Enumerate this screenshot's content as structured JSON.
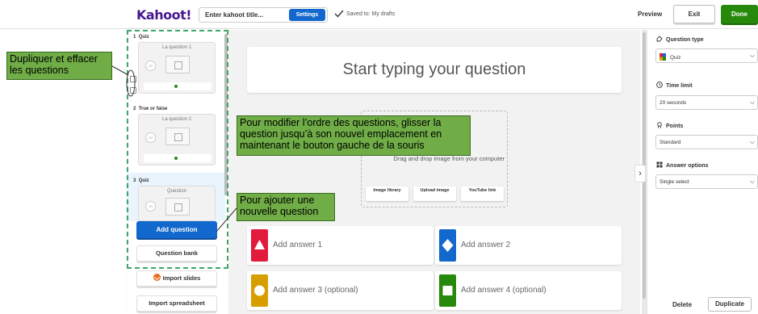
{
  "topbar": {
    "logo": "Kahoot!",
    "title_placeholder": "Enter kahoot title...",
    "settings_label": "Settings",
    "saved_text": "Saved to: My drafts",
    "preview_label": "Preview",
    "exit_label": "Exit",
    "done_label": "Done"
  },
  "slides": [
    {
      "number": "1",
      "type": "Quiz",
      "thumb_title": "La question 1",
      "timer": "20"
    },
    {
      "number": "2",
      "type": "True or false",
      "thumb_title": "La question 2",
      "timer": "20"
    },
    {
      "number": "3",
      "type": "Quiz",
      "thumb_title": "Question",
      "timer": "20"
    }
  ],
  "sidebar": {
    "add_question": "Add question",
    "question_bank": "Question bank",
    "import_slides": "Import slides",
    "import_spreadsheet": "Import spreadsheet"
  },
  "editor": {
    "question_placeholder": "Start typing your question",
    "media_text": "Drag and drop image from your computer",
    "media_buttons": [
      "Image library",
      "Upload image",
      "YouTube link"
    ],
    "answers": [
      {
        "label": "Add answer 1",
        "color": "#e21b3c",
        "shape": "triangle"
      },
      {
        "label": "Add answer 2",
        "color": "#1368ce",
        "shape": "diamond"
      },
      {
        "label": "Add answer 3 (optional)",
        "color": "#d89e00",
        "shape": "circle"
      },
      {
        "label": "Add answer 4 (optional)",
        "color": "#26890c",
        "shape": "square"
      }
    ]
  },
  "right_panel": {
    "question_type_label": "Question type",
    "question_type_value": "Quiz",
    "time_limit_label": "Time limit",
    "time_limit_value": "20 seconds",
    "points_label": "Points",
    "points_value": "Standard",
    "answer_options_label": "Answer options",
    "answer_options_value": "Single select",
    "delete_label": "Delete",
    "duplicate_label": "Duplicate"
  },
  "annotations": {
    "duplicate_delete": "Dupliquer et effacer les questions",
    "reorder": "Pour modifier l’ordre des questions, glisser la question jusqu’à son nouvel emplacement en maintenant le bouton gauche de la souris",
    "add_new": "Pour ajouter une nouvelle question"
  },
  "colors": {
    "brand_purple": "#46178f",
    "primary_blue": "#1368ce",
    "done_green": "#26890c",
    "callout_green": "#70ad47"
  }
}
